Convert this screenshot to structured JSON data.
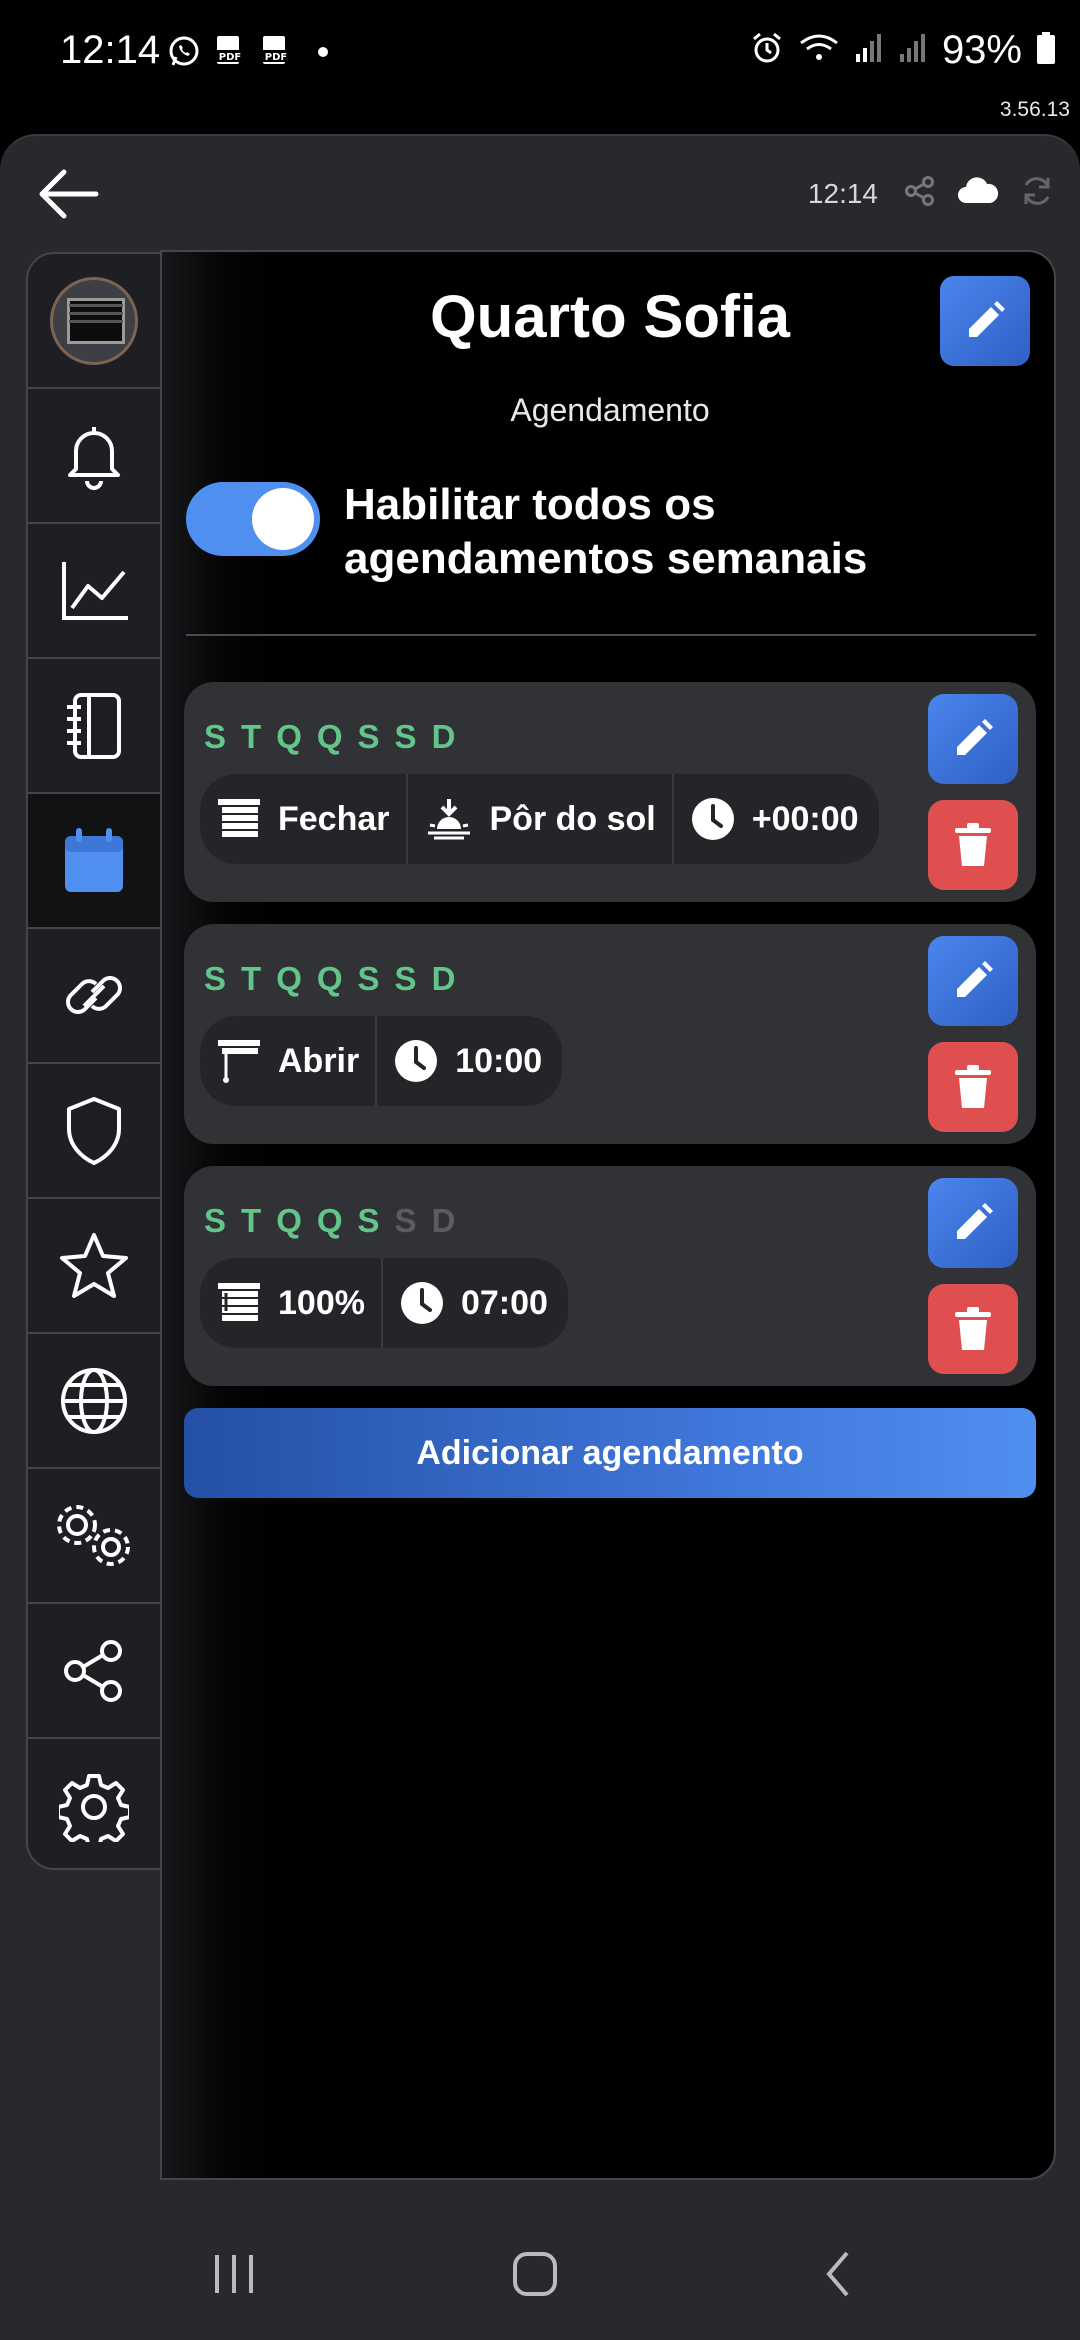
{
  "status_bar": {
    "time": "12:14",
    "battery": "93%"
  },
  "app_version": "3.56.13",
  "topbar": {
    "time": "12:14",
    "icons": [
      "back-arrow-icon",
      "share-icon",
      "cloud-icon",
      "refresh-icon"
    ]
  },
  "sidebar": {
    "items": [
      {
        "name": "avatar",
        "icon": "device-photo"
      },
      {
        "name": "notifications",
        "icon": "bell-icon"
      },
      {
        "name": "charts",
        "icon": "chart-line-icon"
      },
      {
        "name": "log",
        "icon": "notebook-icon"
      },
      {
        "name": "schedule",
        "icon": "calendar-icon",
        "active": true
      },
      {
        "name": "links",
        "icon": "link-icon"
      },
      {
        "name": "security",
        "icon": "shield-icon"
      },
      {
        "name": "favorites",
        "icon": "star-icon"
      },
      {
        "name": "network",
        "icon": "globe-icon"
      },
      {
        "name": "advanced-settings",
        "icon": "gears-icon"
      },
      {
        "name": "share",
        "icon": "share-icon"
      },
      {
        "name": "settings",
        "icon": "gear-icon"
      }
    ]
  },
  "main": {
    "title": "Quarto Sofia",
    "subtitle": "Agendamento",
    "toggle_label": "Habilitar todos os agendamentos semanais",
    "toggle_on": true,
    "add_button": "Adicionar agendamento"
  },
  "schedules": [
    {
      "days": [
        {
          "letter": "S",
          "on": true
        },
        {
          "letter": "T",
          "on": true
        },
        {
          "letter": "Q",
          "on": true
        },
        {
          "letter": "Q",
          "on": true
        },
        {
          "letter": "S",
          "on": true
        },
        {
          "letter": "S",
          "on": true
        },
        {
          "letter": "D",
          "on": true
        }
      ],
      "action": "Fechar",
      "trigger": "Pôr do sol",
      "time": "+00:00"
    },
    {
      "days": [
        {
          "letter": "S",
          "on": true
        },
        {
          "letter": "T",
          "on": true
        },
        {
          "letter": "Q",
          "on": true
        },
        {
          "letter": "Q",
          "on": true
        },
        {
          "letter": "S",
          "on": true
        },
        {
          "letter": "S",
          "on": true
        },
        {
          "letter": "D",
          "on": true
        }
      ],
      "action": "Abrir",
      "time": "10:00"
    },
    {
      "days": [
        {
          "letter": "S",
          "on": true
        },
        {
          "letter": "T",
          "on": true
        },
        {
          "letter": "Q",
          "on": true
        },
        {
          "letter": "Q",
          "on": true
        },
        {
          "letter": "S",
          "on": true
        },
        {
          "letter": "S",
          "on": false
        },
        {
          "letter": "D",
          "on": false
        }
      ],
      "action": "100%",
      "time": "07:00"
    }
  ],
  "colors": {
    "accent_blue": "#4f8ff0",
    "day_on": "#63c58a",
    "day_off": "#5b5c60",
    "delete_red": "#e04f4f",
    "card_bg": "#313236"
  }
}
